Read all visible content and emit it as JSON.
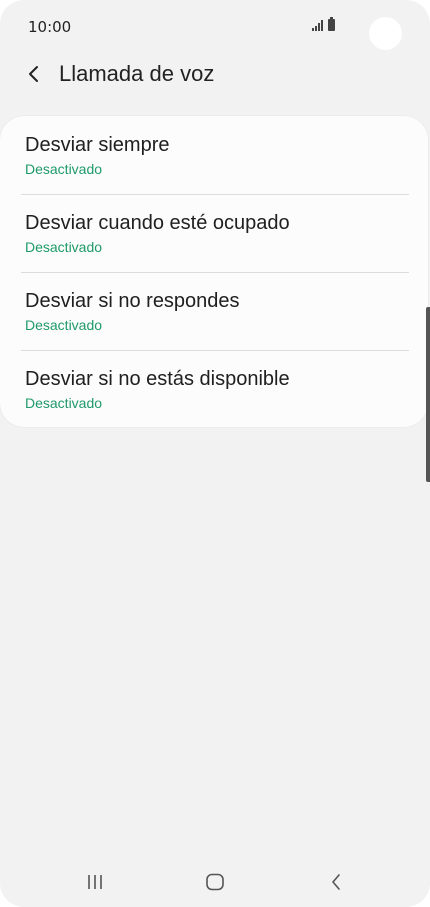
{
  "status_bar": {
    "time": "10:00"
  },
  "header": {
    "title": "Llamada de voz"
  },
  "items": [
    {
      "title": "Desviar siempre",
      "status": "Desactivado"
    },
    {
      "title": "Desviar cuando esté ocupado",
      "status": "Desactivado"
    },
    {
      "title": "Desviar si no respondes",
      "status": "Desactivado"
    },
    {
      "title": "Desviar si no estás disponible",
      "status": "Desactivado"
    }
  ],
  "colors": {
    "background": "#f2f2f2",
    "card": "#fcfcfc",
    "status_accent": "#1f9a6a",
    "text_primary": "#202020"
  },
  "icons": {
    "back": "chevron-left-icon",
    "signal": "signal-icon",
    "battery": "battery-icon",
    "nav_recents": "recents-icon",
    "nav_home": "home-icon",
    "nav_back": "back-icon"
  }
}
